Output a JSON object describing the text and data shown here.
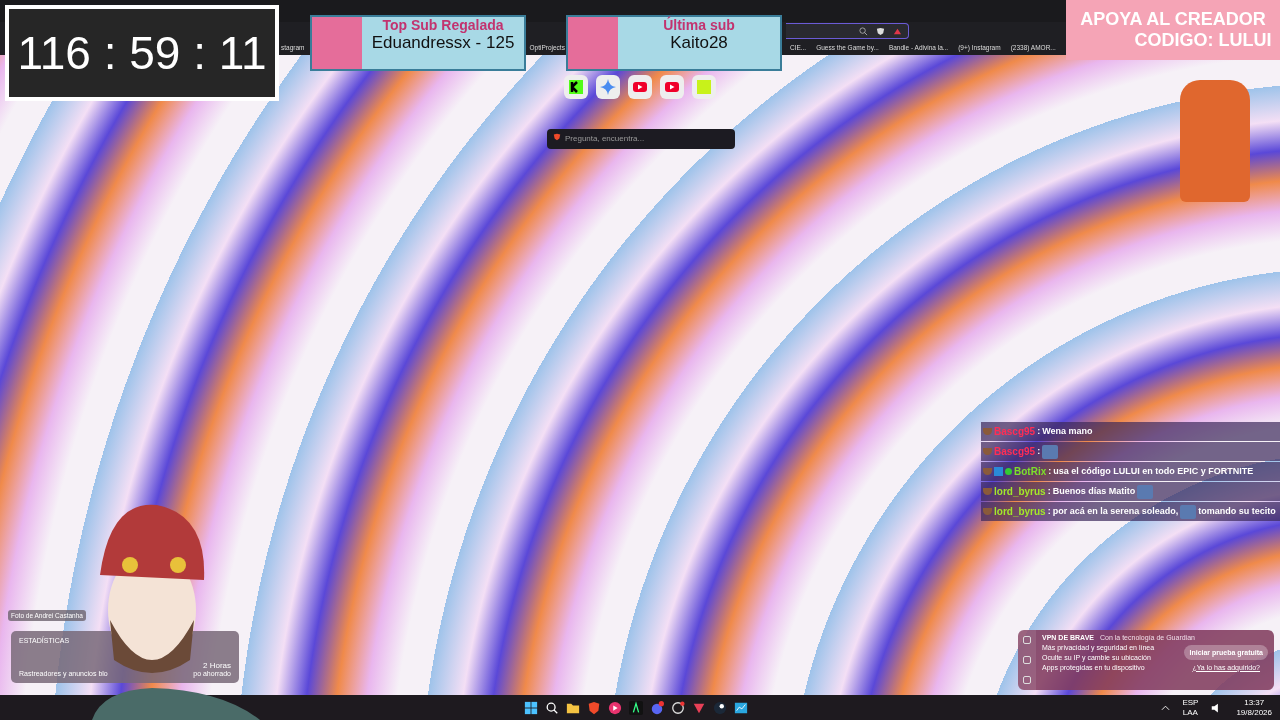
{
  "timer": {
    "text": "116 : 59 : 11"
  },
  "sub_banners": [
    {
      "title": "Top Sub Regalada",
      "value": "Eduandressx - 125"
    },
    {
      "title": "Última sub",
      "value": "Kaito28"
    }
  ],
  "promo": {
    "line_1": "APOYA AL CREADOR",
    "line_2": "CODIGO: LULUI"
  },
  "bookmarks": [
    "stagram",
    "OptiProjects",
    "CIE...",
    "Guess the Game by...",
    "Bandle - Adivina la...",
    "(9+) Instagram",
    "(2338) AMOR..."
  ],
  "search": {
    "placeholder": "Pregunta, encuentra..."
  },
  "chat": [
    {
      "user": "Bascg95",
      "sep": ":",
      "color": "#ff2d55",
      "bot": false,
      "parts": [
        {
          "kind": "text",
          "text": "Wena mano"
        }
      ]
    },
    {
      "user": "Bascg95",
      "sep": ":",
      "color": "#ff2d55",
      "bot": false,
      "parts": [
        {
          "kind": "emote"
        }
      ]
    },
    {
      "user": "BotRix",
      "sep": ":",
      "color": "#7ee02a",
      "bot": true,
      "parts": [
        {
          "kind": "text",
          "text": "usa el código LULUI en todo EPIC y FORTNITE"
        }
      ]
    },
    {
      "user": "lord_byrus",
      "sep": ":",
      "color": "#a4e82a",
      "bot": false,
      "parts": [
        {
          "kind": "text",
          "text": "Buenos días Matito"
        },
        {
          "kind": "emote"
        }
      ]
    },
    {
      "user": "lord_byrus",
      "sep": ":",
      "color": "#a4e82a",
      "bot": false,
      "parts": [
        {
          "kind": "text",
          "text": "por acá en la serena soleado,"
        },
        {
          "kind": "emote"
        },
        {
          "kind": "text",
          "text": "tomando su tecito"
        }
      ]
    }
  ],
  "photo_credit": "Foto de Andrei Castanha",
  "stats": {
    "title": "ESTADÍSTICAS",
    "left_caption": "Rastreadores y anuncios blo",
    "right_value": "2 Horas",
    "right_caption": "po ahorrado"
  },
  "vpn": {
    "title": "VPN DE BRAVE",
    "subtitle": "Con la tecnología de Guardian",
    "features": [
      "Más privacidad y seguridad en línea",
      "Oculte su IP y cambie su ubicación",
      "Apps protegidas en tu dispositivo"
    ],
    "button": "Iniciar prueba gratuita",
    "link": "¿Ya lo has adquirido?"
  },
  "taskbar": {
    "language": "ESP",
    "layout": "LAA",
    "time": "13:37",
    "date": "19/8/2026"
  }
}
